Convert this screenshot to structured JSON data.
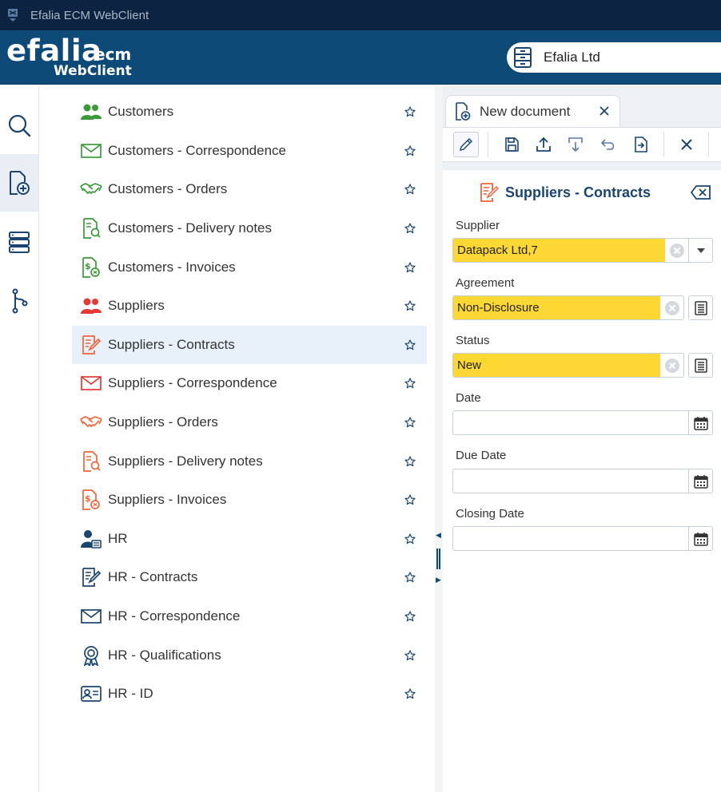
{
  "window": {
    "title": "Efalia ECM WebClient"
  },
  "logo": {
    "line1": "efalia",
    "line2": "ecm",
    "line3": "WebClient"
  },
  "company": {
    "name": "Efalia Ltd",
    "icon": "filing-cabinet-icon"
  },
  "rail": {
    "items": [
      {
        "name": "search",
        "icon": "search-icon"
      },
      {
        "name": "new-document",
        "icon": "new-document-icon",
        "active": true
      },
      {
        "name": "storage",
        "icon": "database-icon"
      },
      {
        "name": "workflow",
        "icon": "workflow-branch-icon"
      }
    ]
  },
  "list": {
    "items": [
      {
        "label": "Customers",
        "icon": "users-icon",
        "color": "#3a9a3a"
      },
      {
        "label": "Customers - Correspondence",
        "icon": "envelope-icon",
        "color": "#3a9a3a"
      },
      {
        "label": "Customers - Orders",
        "icon": "handshake-icon",
        "color": "#3a9a3a"
      },
      {
        "label": "Customers - Delivery notes",
        "icon": "delivery-note-icon",
        "color": "#3a9a3a"
      },
      {
        "label": "Customers - Invoices",
        "icon": "invoice-icon",
        "color": "#3a9a3a"
      },
      {
        "label": "Suppliers",
        "icon": "users-icon",
        "color": "#e53935"
      },
      {
        "label": "Suppliers - Contracts",
        "icon": "contract-icon",
        "color": "#f0643c",
        "selected": true
      },
      {
        "label": "Suppliers - Correspondence",
        "icon": "envelope-icon",
        "color": "#e53935"
      },
      {
        "label": "Suppliers - Orders",
        "icon": "handshake-icon",
        "color": "#f0643c"
      },
      {
        "label": "Suppliers - Delivery notes",
        "icon": "delivery-note-icon",
        "color": "#f0643c"
      },
      {
        "label": "Suppliers - Invoices",
        "icon": "invoice-icon",
        "color": "#f0643c"
      },
      {
        "label": "HR",
        "icon": "hr-user-icon",
        "color": "#1a4570"
      },
      {
        "label": "HR - Contracts",
        "icon": "contract-icon",
        "color": "#1a4570"
      },
      {
        "label": "HR - Correspondence",
        "icon": "envelope-icon",
        "color": "#1a4570"
      },
      {
        "label": "HR - Qualifications",
        "icon": "award-icon",
        "color": "#1a4570"
      },
      {
        "label": "HR - ID",
        "icon": "id-card-icon",
        "color": "#1a4570"
      }
    ]
  },
  "tab": {
    "label": "New document"
  },
  "toolbar": {
    "buttons": [
      "edit-icon",
      "save-icon",
      "upload-icon",
      "download-icon",
      "undo-icon",
      "export-icon",
      "close-icon"
    ]
  },
  "form": {
    "title": "Suppliers - Contracts",
    "fields": [
      {
        "label": "Supplier",
        "value": "Datapack Ltd,7",
        "type": "dropdown"
      },
      {
        "label": "Agreement",
        "value": "Non-Disclosure",
        "type": "list"
      },
      {
        "label": "Status",
        "value": "New",
        "type": "list"
      },
      {
        "label": "Date",
        "value": "",
        "type": "date"
      },
      {
        "label": "Due Date",
        "value": "",
        "type": "date"
      },
      {
        "label": "Closing Date",
        "value": "",
        "type": "date"
      }
    ]
  },
  "colors": {
    "titlebar": "#0c2341",
    "header": "#0e4a78",
    "accent": "#1a4570",
    "highlight": "#fdd835"
  }
}
